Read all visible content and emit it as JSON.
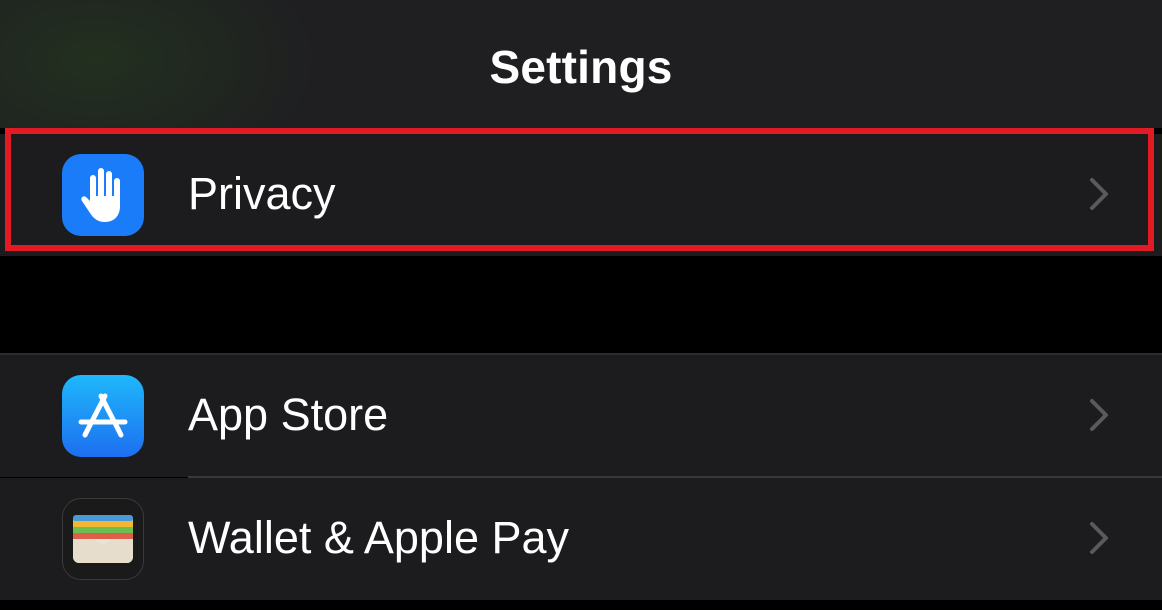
{
  "header": {
    "title": "Settings"
  },
  "rows": [
    {
      "label": "Privacy",
      "icon": "hand-raised-icon",
      "icon_color": "#1a7cf8",
      "highlighted": true
    },
    {
      "label": "App Store",
      "icon": "app-store-icon",
      "icon_color": "#1d8cf5"
    },
    {
      "label": "Wallet & Apple Pay",
      "icon": "wallet-icon",
      "icon_color": "#1a1a1a"
    }
  ],
  "colors": {
    "background": "#000000",
    "cell": "#1c1c1e",
    "highlight_border": "#e01b24",
    "chevron": "#5a5a5e",
    "text": "#ffffff"
  }
}
